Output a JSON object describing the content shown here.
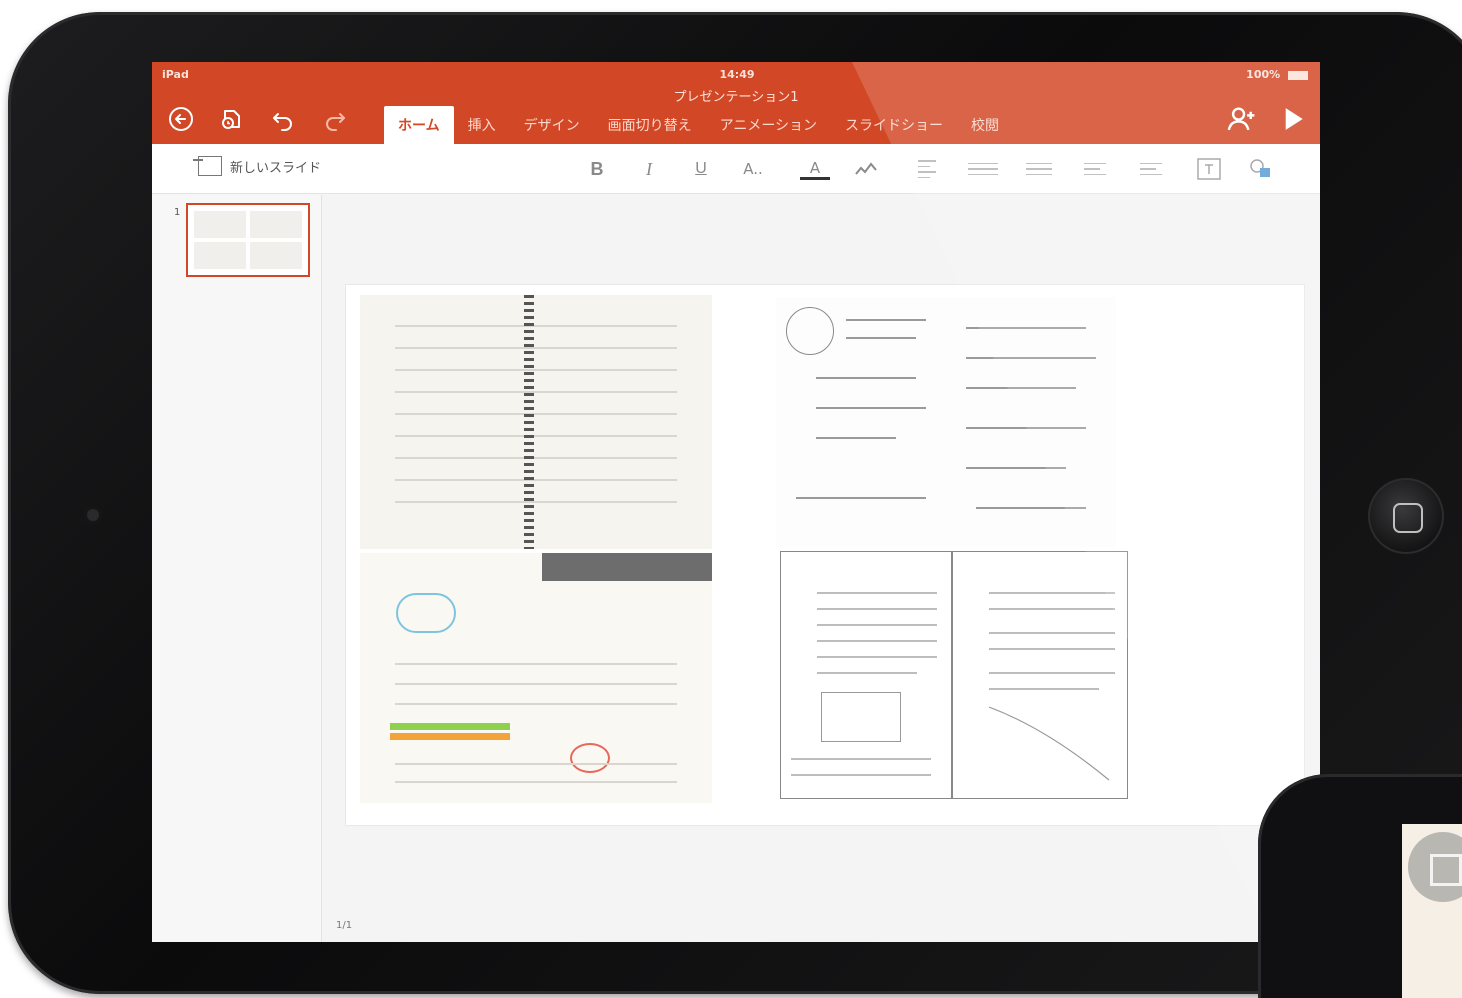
{
  "status_bar": {
    "device": "iPad",
    "time": "14:49",
    "battery": "100%"
  },
  "document": {
    "title": "プレゼンテーション1"
  },
  "ribbon_tabs": [
    {
      "label": "ホーム",
      "active": true
    },
    {
      "label": "挿入",
      "active": false
    },
    {
      "label": "デザイン",
      "active": false
    },
    {
      "label": "画面切り替え",
      "active": false
    },
    {
      "label": "アニメーション",
      "active": false
    },
    {
      "label": "スライドショー",
      "active": false
    },
    {
      "label": "校閲",
      "active": false
    }
  ],
  "toolbar": {
    "new_slide_label": "新しいスライド",
    "bold": "B",
    "italic": "I",
    "underline": "U",
    "font_size": "A..",
    "font_color": "A"
  },
  "slides_pane": {
    "slide_number": "1"
  },
  "footer": {
    "page_count": "1/1"
  },
  "colors": {
    "accent": "#d24726",
    "selection": "#d24726"
  }
}
